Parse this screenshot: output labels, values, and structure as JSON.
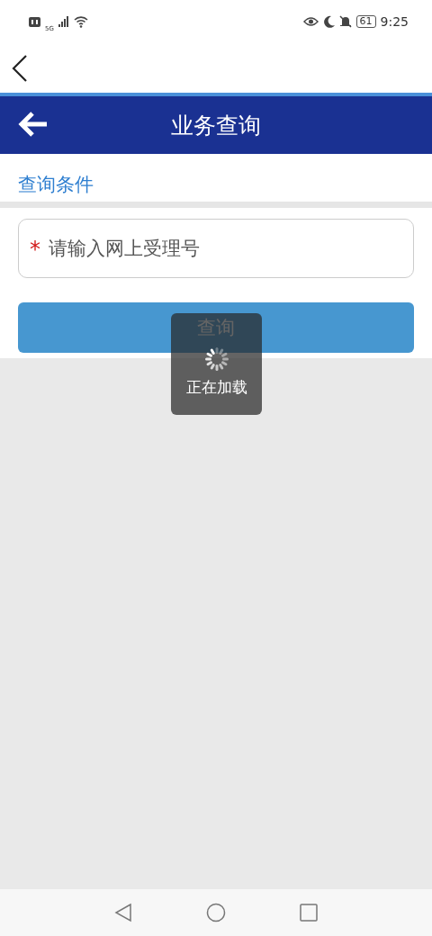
{
  "status_bar": {
    "network": "5G",
    "battery": "61",
    "time": "9:25"
  },
  "header": {
    "title": "业务查询"
  },
  "section": {
    "title": "查询条件"
  },
  "field": {
    "required_mark": "*",
    "placeholder": "请输入网上受理号"
  },
  "button": {
    "label": "查询"
  },
  "loading": {
    "text": "正在加载"
  }
}
